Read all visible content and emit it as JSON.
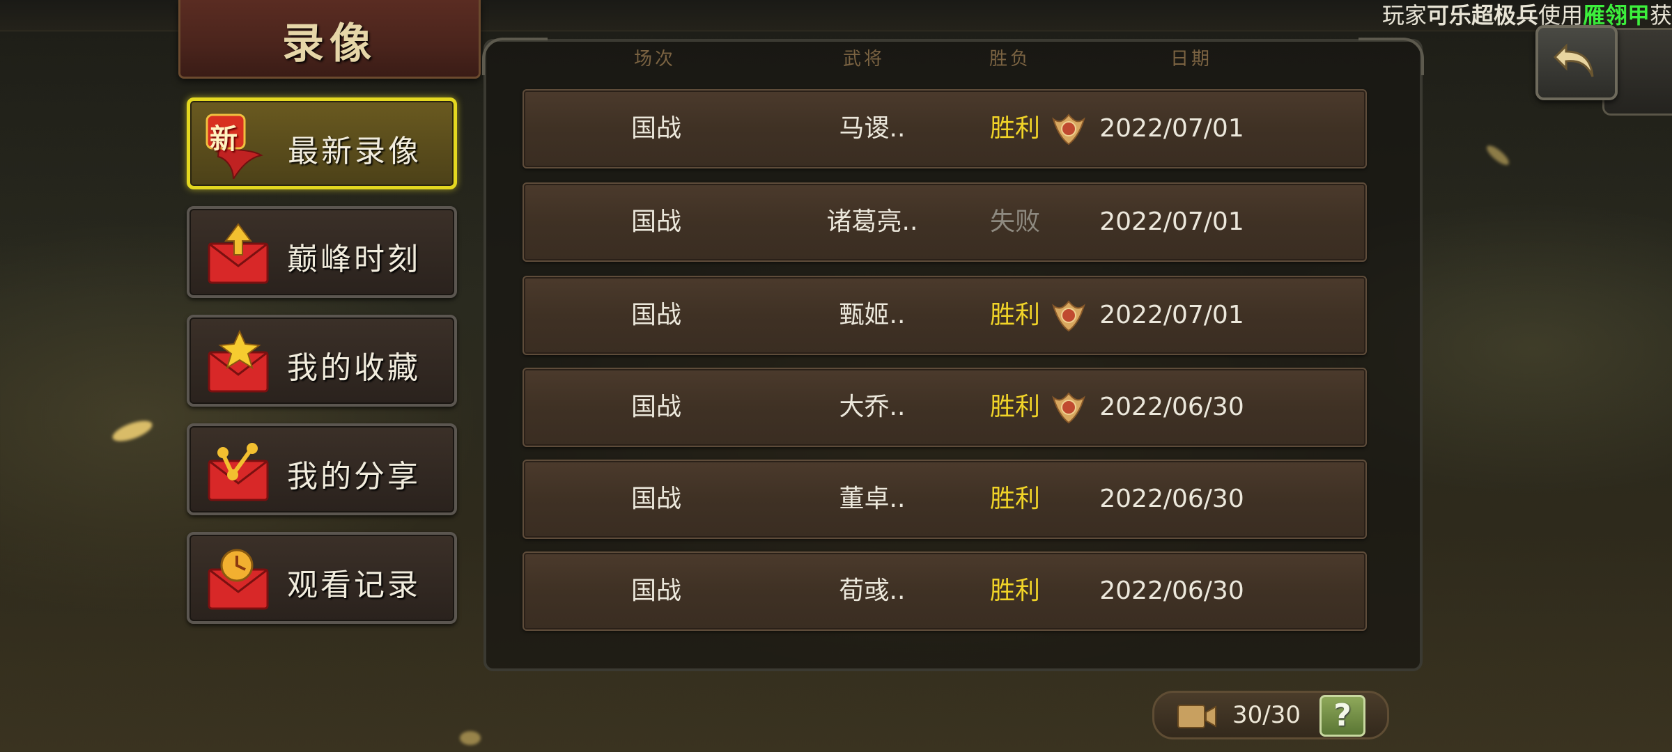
{
  "title": "录像",
  "marquee": {
    "prefix": "玩家",
    "player": "可乐超极兵",
    "mid": "使用",
    "item": "雁翎甲",
    "suffix": "获"
  },
  "sidebar": {
    "items": [
      {
        "label": "最新录像",
        "icon": "new-ribbon-icon",
        "badge": "新",
        "active": true
      },
      {
        "label": "巅峰时刻",
        "icon": "envelope-arrow-icon",
        "active": false
      },
      {
        "label": "我的收藏",
        "icon": "envelope-star-icon",
        "active": false
      },
      {
        "label": "我的分享",
        "icon": "envelope-share-icon",
        "active": false
      },
      {
        "label": "观看记录",
        "icon": "envelope-clock-icon",
        "active": false
      }
    ]
  },
  "table": {
    "headers": [
      "场次",
      "武将",
      "胜负",
      "日期"
    ],
    "rows": [
      {
        "type": "国战",
        "general": "马谡..",
        "result": "胜利",
        "medal": true,
        "date": "2022/07/01"
      },
      {
        "type": "国战",
        "general": "诸葛亮..",
        "result": "失败",
        "medal": false,
        "date": "2022/07/01"
      },
      {
        "type": "国战",
        "general": "甄姬..",
        "result": "胜利",
        "medal": true,
        "date": "2022/07/01"
      },
      {
        "type": "国战",
        "general": "大乔..",
        "result": "胜利",
        "medal": true,
        "date": "2022/06/30"
      },
      {
        "type": "国战",
        "general": "董卓..",
        "result": "胜利",
        "medal": false,
        "date": "2022/06/30"
      },
      {
        "type": "国战",
        "general": "荀彧..",
        "result": "胜利",
        "medal": false,
        "date": "2022/06/30"
      }
    ]
  },
  "footer": {
    "count": "30/30",
    "help": "?"
  },
  "colors": {
    "win": "#f1d428",
    "lose": "#8e8a80",
    "active_border": "#e4d820"
  }
}
